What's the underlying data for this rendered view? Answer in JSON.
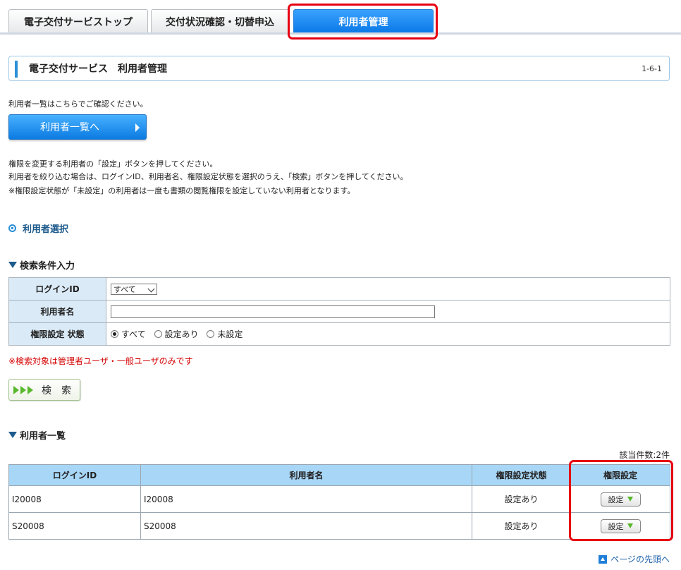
{
  "tabs": [
    {
      "label": "電子交付サービストップ"
    },
    {
      "label": "交付状況確認・切替申込"
    },
    {
      "label": "利用者管理"
    }
  ],
  "header": {
    "title": "電子交付サービス　利用者管理",
    "page_id": "1-6-1"
  },
  "intro": {
    "list_text": "利用者一覧はこちらでご確認ください。",
    "list_button": "利用者一覧へ",
    "line1": "権限を変更する利用者の「設定」ボタンを押してください。",
    "line2": "利用者を絞り込む場合は、ログインID、利用者名、権限設定状態を選択のうえ、「検索」ボタンを押してください。",
    "line3": "※権限設定状態が「未設定」の利用者は一度も書類の閲覧権限を設定していない利用者となります。"
  },
  "section_title": "利用者選択",
  "search": {
    "heading": "検索条件入力",
    "login_label": "ログインID",
    "login_value": "すべて",
    "name_label": "利用者名",
    "name_value": "",
    "status_label": "権限設定 状態",
    "status_options": [
      "すべて",
      "設定あり",
      "未設定"
    ],
    "status_selected": "すべて",
    "note": "※検索対象は管理者ユーザ・一般ユーザのみです",
    "button": "検　索"
  },
  "results": {
    "heading": "利用者一覧",
    "count": "該当件数:2件",
    "columns": [
      "ログインID",
      "利用者名",
      "権限設定状態",
      "権限設定"
    ],
    "rows": [
      {
        "login": "I20008",
        "name": "I20008",
        "status": "設定あり",
        "action": "設定"
      },
      {
        "login": "S20008",
        "name": "S20008",
        "status": "設定あり",
        "action": "設定"
      }
    ]
  },
  "page_top": "ページの先頭へ",
  "colors": {
    "accent": "#0a78e6",
    "highlight": "#e60012",
    "note": "#d40000"
  }
}
